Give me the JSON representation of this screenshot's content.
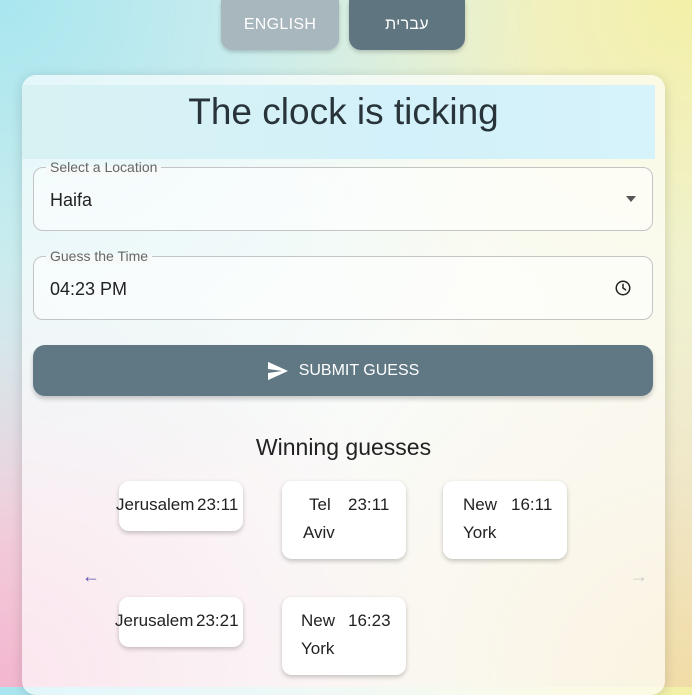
{
  "language_switch": {
    "english": "ENGLISH",
    "hebrew": "עברית"
  },
  "title": "The clock is ticking",
  "location_field": {
    "label": "Select a Location",
    "value": "Haifa"
  },
  "time_field": {
    "label": "Guess the Time",
    "value": "04:23 PM"
  },
  "submit_label": "SUBMIT GUESS",
  "winning": {
    "title": "Winning guesses",
    "nav_prev": "←",
    "nav_next": "→",
    "guesses": [
      {
        "city": "Jerusalem",
        "time": "23:11"
      },
      {
        "city": "Tel Aviv",
        "city_line1": "Tel",
        "city_line2": "Aviv",
        "time": "23:11"
      },
      {
        "city": "New York",
        "city_line1": "New",
        "city_line2": "York",
        "time": "16:11"
      },
      {
        "city": "Jerusalem",
        "time": "23:21"
      },
      {
        "city": "New York",
        "city_line1": "New",
        "city_line2": "York",
        "time": "16:23"
      }
    ]
  },
  "icons": {
    "submit": "send-icon",
    "time": "clock-icon",
    "select": "chevron-down-icon"
  },
  "colors": {
    "primary": "#607784",
    "english_button": "#a8b6bd"
  }
}
